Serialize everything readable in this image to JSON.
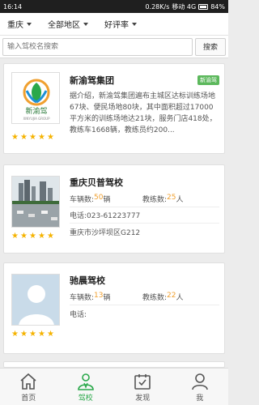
{
  "status": {
    "time": "16:14",
    "network": "0.28K/s",
    "carrier": "移动 4G",
    "battery": "84%"
  },
  "filters": [
    {
      "label": "重庆"
    },
    {
      "label": "全部地区"
    },
    {
      "label": "好评率"
    }
  ],
  "search": {
    "placeholder": "输入驾校名搜索",
    "button": "搜索"
  },
  "cards": [
    {
      "title": "新渝驾集团",
      "badge": "新渝驾",
      "logo_text": "新渝驾",
      "logo_sub": "XINYUJIA GROUP",
      "description": "据介绍，新渝驾集团遍布主城区达标训练场地67块、便民场地80块，其中面积超过17000平方米的训练场地达21块，服务门店418处，教练车1668辆，教练员约200...",
      "stars": 5
    },
    {
      "title": "重庆贝普驾校",
      "cars_label": "车辆数:",
      "cars_value": "50",
      "cars_unit": "辆",
      "coaches_label": "教练数:",
      "coaches_value": "25",
      "coaches_unit": "人",
      "phone": "电话:023-61223777",
      "address": "重庆市沙坪坝区G212",
      "stars": 5
    },
    {
      "title": "驰晨驾校",
      "cars_label": "车辆数:",
      "cars_value": "13",
      "cars_unit": "辆",
      "coaches_label": "教练数:",
      "coaches_value": "22",
      "coaches_unit": "人",
      "phone": "电话:",
      "stars": 5
    }
  ],
  "tabs": [
    {
      "label": "首页",
      "icon": "home-icon",
      "active": false
    },
    {
      "label": "驾校",
      "icon": "person-icon",
      "active": true
    },
    {
      "label": "发现",
      "icon": "calendar-icon",
      "active": false
    },
    {
      "label": "我",
      "icon": "user-icon",
      "active": false
    }
  ],
  "colors": {
    "accent": "#2aa84a",
    "star": "#f5b301",
    "highlight": "#f0a030",
    "badge": "#5cb85c"
  }
}
